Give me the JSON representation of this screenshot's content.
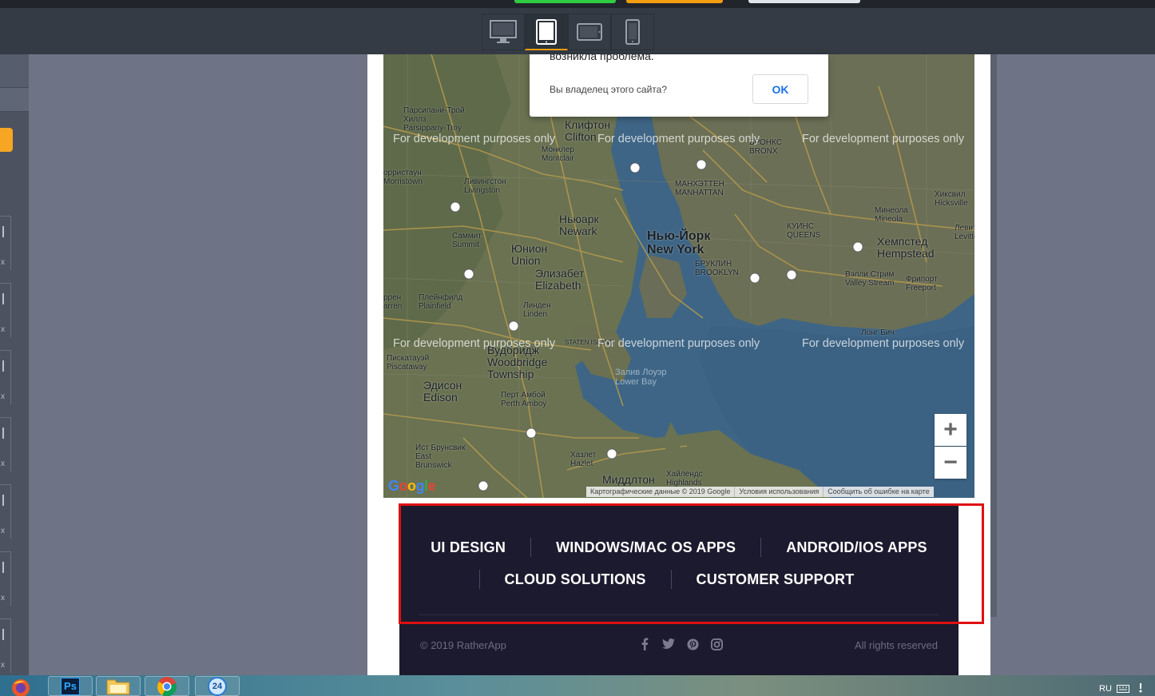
{
  "toolbar": {
    "devices": [
      "desktop-icon",
      "tablet-icon",
      "tablet-landscape-icon",
      "phone-icon"
    ],
    "active_device": "tablet-icon",
    "accent_color": "#f39c12"
  },
  "dialog": {
    "title": "возникла проблема.",
    "question": "Вы владелец этого сайта?",
    "ok_label": "OK"
  },
  "map": {
    "watermark": "For development purposes only",
    "places": {
      "parsippany": "Парсипани-Трой\nХиллз\nParsippany-Troy",
      "clifton": "Клифтон\nClifton",
      "montclair": "Монклер\nMontclair",
      "morristown": "орристаун\nMorristown",
      "livingston": "Ливингстон\nLivingston",
      "manhattan": "МАНХЭТТЕН\nMANHATTAN",
      "bronx": "БРОНКС\nBRONX",
      "newark": "Ньюарк\nNewark",
      "newyork": "Нью-Йорк\nNew York",
      "queens": "КУИНС\nQUEENS",
      "mineola": "Минеола\nMineola",
      "hicksville": "Хиксвил\nHicksville",
      "levittown": "Левитт\nLevittо",
      "hempstead": "Хемпстед\nHempstead",
      "summit": "Саммит\nSummit",
      "union": "Юнион\nUnion",
      "elizabeth": "Элизабет\nElizabeth",
      "brooklyn": "БРУКЛИН\nBROOKLYN",
      "valleystream": "Вэлли Стрим\nValley Stream",
      "freeport": "Фрипорт\nFreeport",
      "plainfield": "Плейнфилд\nPlainfield",
      "warren": "ррен\narren",
      "linden": "Линден\nLinden",
      "statenisland": "STATEN ISLAND",
      "longbeach": "Лонг Бич",
      "woodbridge": "Вудбридж\nWoodbridge\nTownship",
      "piscataway": "Пискатауэй\nPiscataway",
      "edison": "Эдисон\nEdison",
      "perthamboy": "Перт Амбой\nPerth Amboy",
      "lowerbay": "Залив Лоуэр\nLower Bay",
      "eastbrunswick": "Ист Брунсвик\nEast\nBrunswick",
      "hazlet": "Хазлет\nHazlet",
      "highlands": "Хайлендс\nHighlands",
      "middletown": "Миддлтон"
    },
    "zoom_in_label": "+",
    "zoom_out_label": "−",
    "attribution": [
      "Картографические данные © 2019 Google",
      "Условия использования",
      "Сообщить об ошибке на карте"
    ],
    "logo": "Google"
  },
  "footer": {
    "nav_row1": [
      "UI DESIGN",
      "WINDOWS/MAC OS APPS",
      "ANDROID/IOS APPS"
    ],
    "nav_row2": [
      "CLOUD SOLUTIONS",
      "CUSTOMER SUPPORT"
    ],
    "copyright": "© 2019 RatherApp",
    "rights": "All rights reserved",
    "socials": [
      "facebook-icon",
      "twitter-icon",
      "pinterest-icon",
      "instagram-icon"
    ]
  },
  "taskbar": {
    "apps": [
      "firefox-icon",
      "photoshop-icon",
      "folder-icon",
      "chrome-icon",
      "app-24-icon"
    ],
    "ps_label": "Ps",
    "badge_label": "24",
    "language": "RU"
  },
  "highlight_color": "#e01010"
}
